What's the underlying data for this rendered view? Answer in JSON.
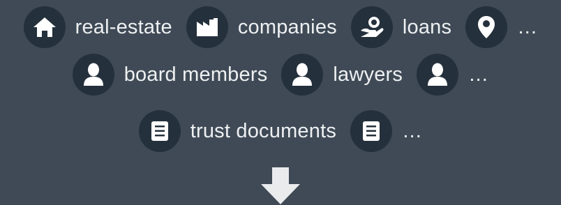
{
  "rows": [
    {
      "items": [
        {
          "icon": "home-icon",
          "label": "real-estate"
        },
        {
          "icon": "factory-icon",
          "label": "companies"
        },
        {
          "icon": "money-hand-icon",
          "label": "loans"
        },
        {
          "icon": "map-pin-icon",
          "label": "…"
        }
      ]
    },
    {
      "items": [
        {
          "icon": "person-icon",
          "label": "board members"
        },
        {
          "icon": "person-icon",
          "label": "lawyers"
        },
        {
          "icon": "person-icon",
          "label": "…"
        }
      ]
    },
    {
      "items": [
        {
          "icon": "document-icon",
          "label": "trust documents"
        },
        {
          "icon": "document-icon",
          "label": "…"
        }
      ]
    }
  ],
  "colors": {
    "background": "#3f4a56",
    "badge": "#24303b",
    "icon": "#ffffff",
    "text": "#eef0f2",
    "arrow": "#e9ebed"
  },
  "arrow_icon": "down-arrow-icon"
}
